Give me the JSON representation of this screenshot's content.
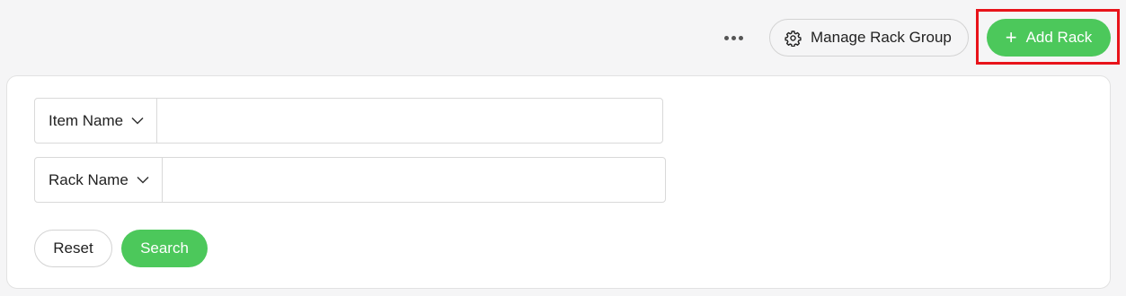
{
  "toolbar": {
    "more_icon": "ellipsis-icon",
    "manage_label": "Manage Rack Group",
    "manage_icon": "gear-icon",
    "add_label": "Add Rack",
    "add_icon": "plus-icon",
    "accent_color": "#4cc85b",
    "highlight_color": "#e8131a"
  },
  "filters": {
    "item_name": {
      "selected": "Item Name",
      "value": "",
      "placeholder": ""
    },
    "rack_name": {
      "selected": "Rack Name",
      "value": "",
      "placeholder": ""
    }
  },
  "actions": {
    "reset_label": "Reset",
    "search_label": "Search"
  }
}
